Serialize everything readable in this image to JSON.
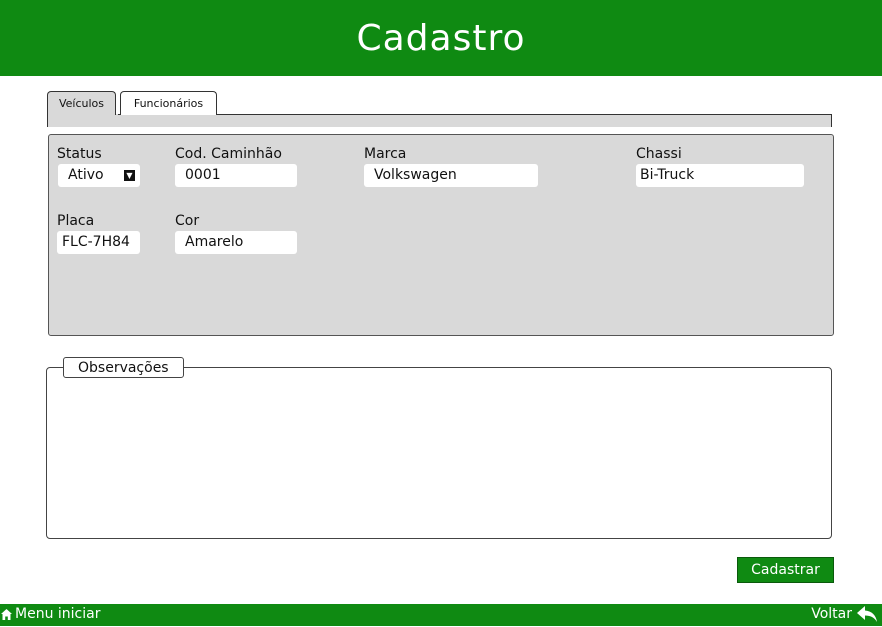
{
  "header": {
    "title": "Cadastro"
  },
  "tabs": [
    {
      "label": "Veículos",
      "active": true
    },
    {
      "label": "Funcionários",
      "active": false
    }
  ],
  "form": {
    "status": {
      "label": "Status",
      "value": "Ativo"
    },
    "cod_caminhao": {
      "label": "Cod. Caminhão",
      "value": "0001"
    },
    "marca": {
      "label": "Marca",
      "value": "Volkswagen"
    },
    "chassi": {
      "label": "Chassi",
      "value": "Bi-Truck"
    },
    "placa": {
      "label": "Placa",
      "value": "FLC-7H84"
    },
    "cor": {
      "label": "Cor",
      "value": "Amarelo"
    }
  },
  "observacoes": {
    "legend": "Observações",
    "value": ""
  },
  "actions": {
    "submit_label": "Cadastrar"
  },
  "footer": {
    "menu_label": "Menu iniciar",
    "back_label": "Voltar"
  },
  "colors": {
    "primary_green": "#0f8a12",
    "panel_gray": "#d9d9d9"
  },
  "icons": {
    "menu": "home-icon",
    "back": "back-arrow-icon",
    "select": "dropdown-icon"
  }
}
